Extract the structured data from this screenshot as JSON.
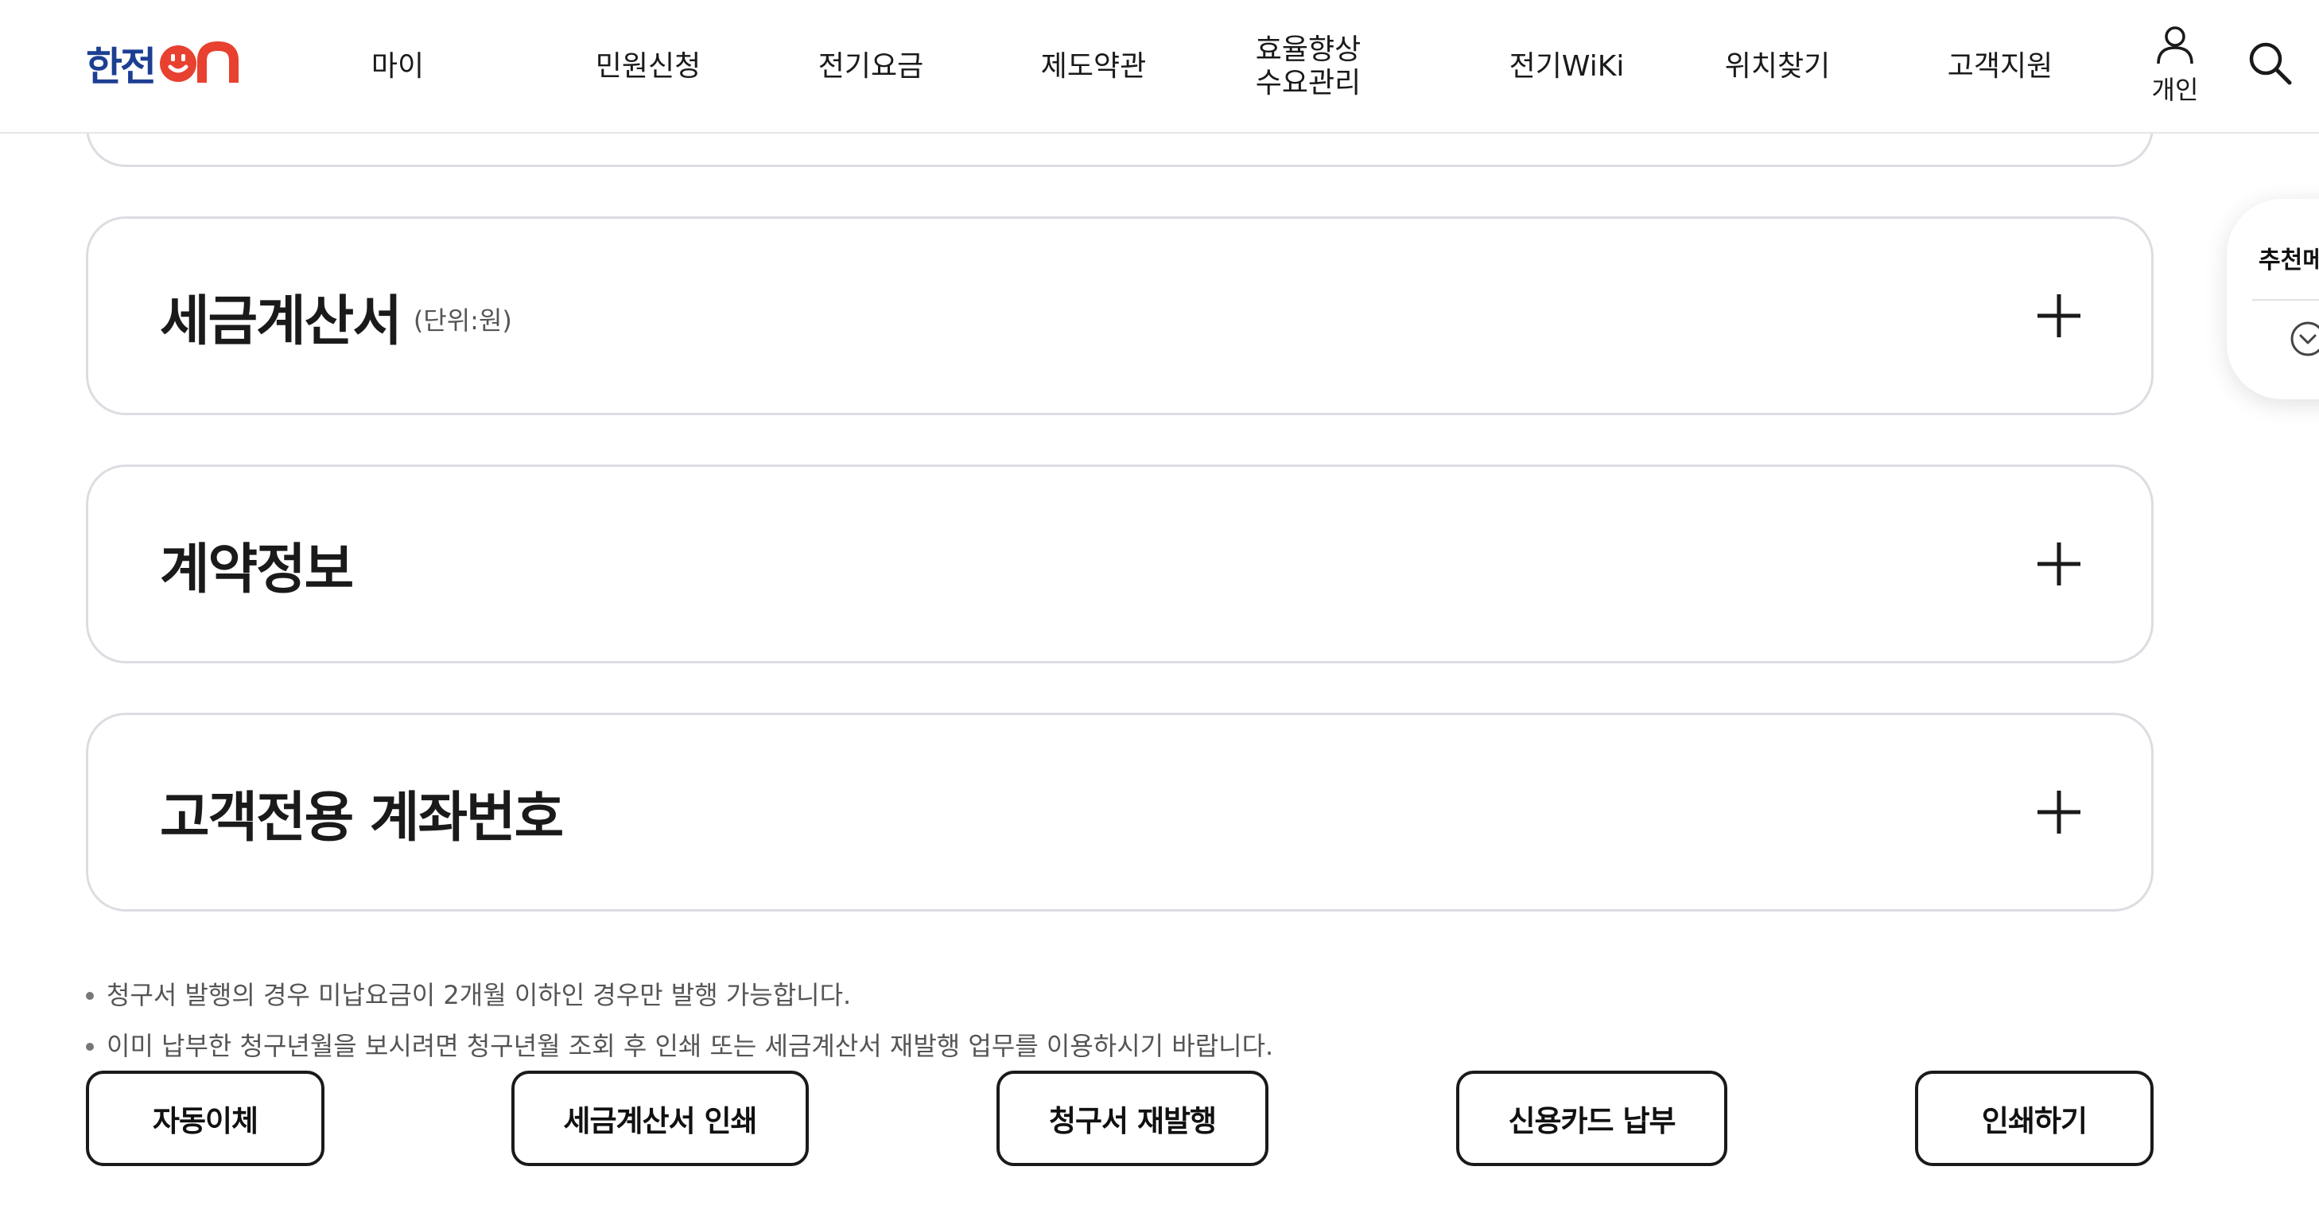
{
  "header": {
    "logo_text": "한전",
    "logo_suffix": "on",
    "nav": [
      {
        "label": "마이"
      },
      {
        "label": "민원신청"
      },
      {
        "label": "전기요금"
      },
      {
        "label": "제도약관"
      },
      {
        "line1": "효율향상",
        "line2": "수요관리"
      },
      {
        "label": "전기WiKi"
      },
      {
        "label": "위치찾기"
      },
      {
        "label": "고객지원"
      }
    ],
    "user_label": "개인",
    "icons": {
      "user": "user-icon",
      "search": "search-icon"
    }
  },
  "accordion": [
    {
      "title": "세금계산서",
      "unit": "(단위:원)"
    },
    {
      "title": "계약정보",
      "unit": ""
    },
    {
      "title": "고객전용 계좌번호",
      "unit": ""
    }
  ],
  "notes": [
    "청구서 발행의 경우 미납요금이 2개월 이하인 경우만 발행 가능합니다.",
    "이미 납부한 청구년월을 보시려면 청구년월 조회 후 인쇄 또는 세금계산서 재발행 업무를 이용하시기 바랍니다."
  ],
  "buttons": {
    "auto_pay": "자동이체",
    "tax_invoice_print": "세금계산서 인쇄",
    "bill_reissue": "청구서 재발행",
    "card_pay": "신용카드 납부",
    "print": "인쇄하기"
  },
  "side_panel": {
    "title": "추천메"
  },
  "colors": {
    "brand_blue": "#1d3f93",
    "brand_red": "#e8412f",
    "border": "#dcdde2"
  }
}
